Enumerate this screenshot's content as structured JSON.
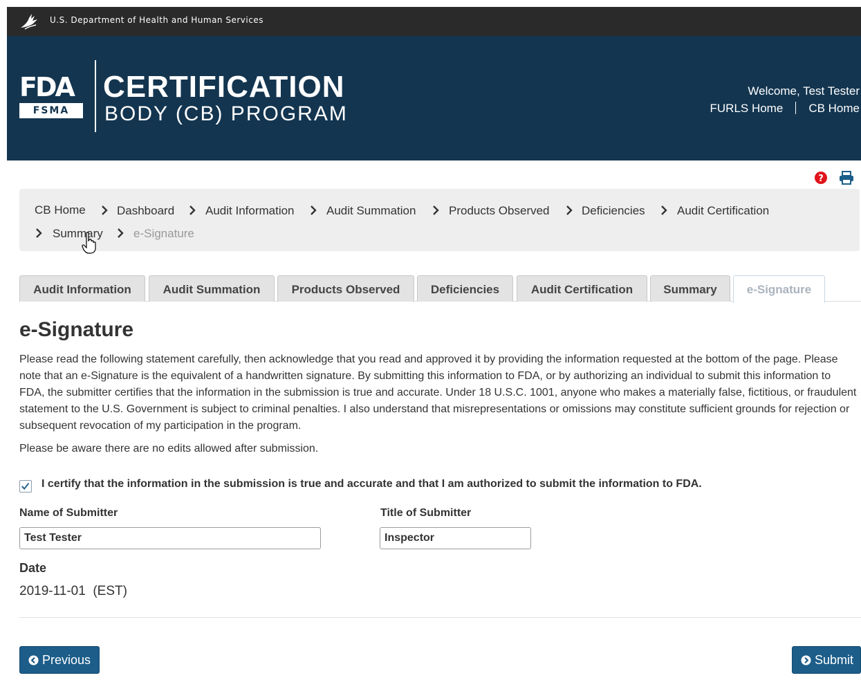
{
  "hhs_bar": {
    "text": "U.S. Department of Health and Human Services"
  },
  "header": {
    "logo_top": "FDA",
    "logo_bottom": "FSMA",
    "title_line1": "CERTIFICATION",
    "title_line2": "BODY (CB) PROGRAM",
    "welcome": "Welcome, Test Tester",
    "links": [
      "FURLS Home",
      "CB Home"
    ]
  },
  "toolbar": {
    "icons": [
      "help-icon",
      "print-icon"
    ],
    "help_color": "#e0141b"
  },
  "breadcrumb": {
    "items": [
      "CB Home",
      "Dashboard",
      "Audit Information",
      "Audit Summation",
      "Products Observed",
      "Deficiencies",
      "Audit Certification",
      "Summary",
      "e-Signature"
    ],
    "active_index": 8
  },
  "tabs": {
    "items": [
      "Audit Information",
      "Audit Summation",
      "Products Observed",
      "Deficiencies",
      "Audit Certification",
      "Summary",
      "e-Signature"
    ],
    "active_index": 6
  },
  "page": {
    "title": "e-Signature",
    "statement": "Please read the following statement carefully, then acknowledge that you read and approved it by providing the information requested at the bottom of the page. Please note that an e-Signature is the equivalent of a handwritten signature. By submitting this information to FDA, or by authorizing an individual to submit this information to FDA, the submitter certifies that the information in the submission is true and accurate. Under 18 U.S.C. 1001, anyone who makes a materially false, fictitious, or fraudulent statement to the U.S. Government is subject to criminal penalties. I also understand that misrepresentations or omissions may constitute sufficient grounds for rejection or subsequent revocation of my participation in the program.",
    "aware": "Please be aware there are no edits allowed after submission."
  },
  "certify": {
    "checked": true,
    "label": "I certify that the information in the submission is true and accurate and that I am authorized to submit the information to FDA."
  },
  "form": {
    "name_label": "Name of Submitter",
    "name_value": "Test Tester",
    "title_label": "Title of Submitter",
    "title_value": "Inspector",
    "date_label": "Date",
    "date_value": "2019-11-01  (EST)"
  },
  "buttons": {
    "previous": "Previous",
    "submit": "Submit"
  },
  "colors": {
    "hhs_bar": "#2a2a2a",
    "header": "#133550",
    "button": "#1c5d89",
    "breadcrumb_bg": "#eeeeee"
  }
}
